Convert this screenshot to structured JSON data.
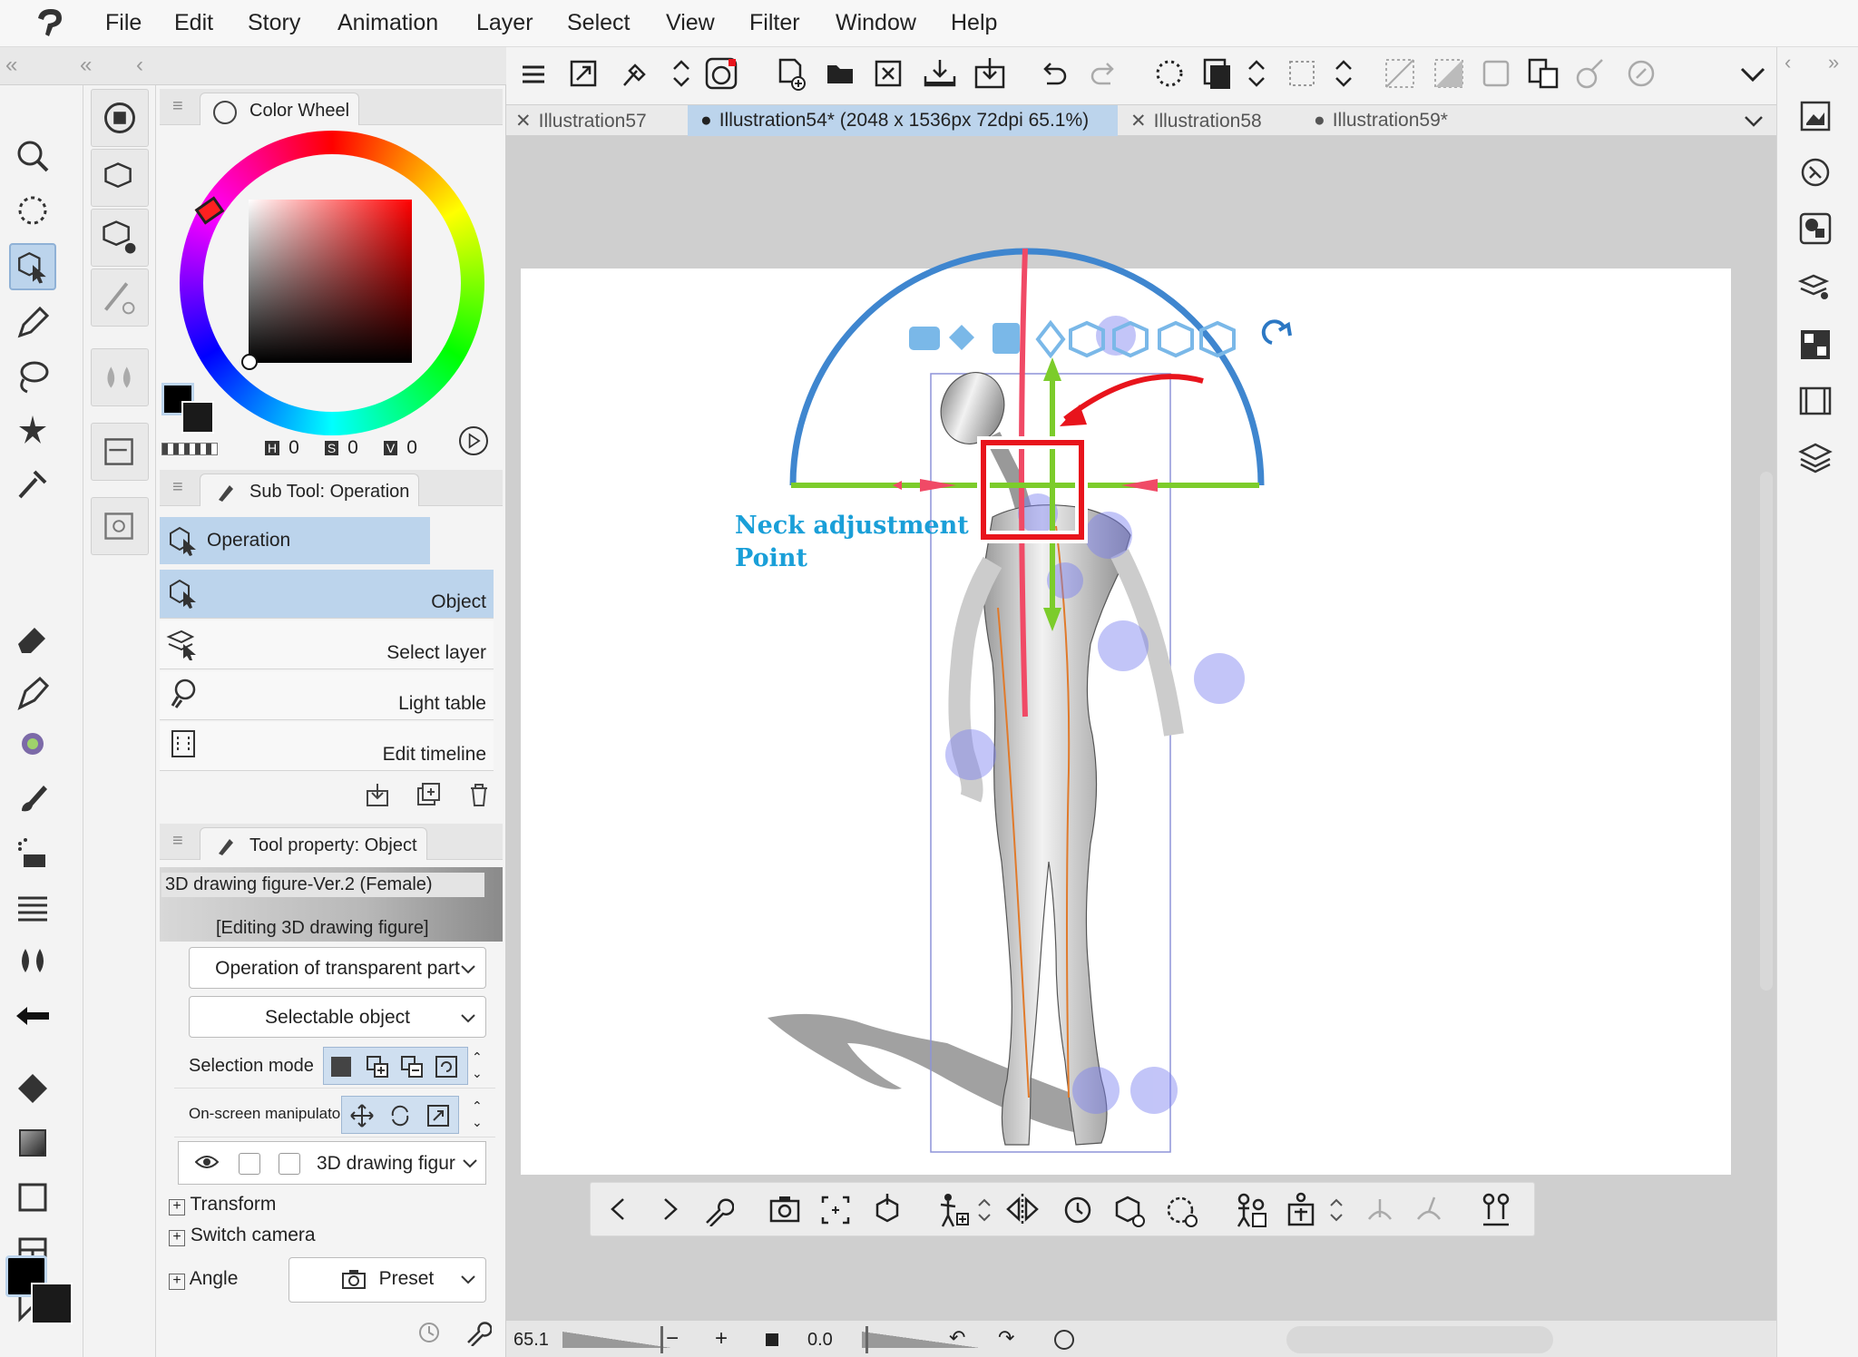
{
  "menu": [
    "File",
    "Edit",
    "Story",
    "Animation",
    "Layer",
    "Select",
    "View",
    "Filter",
    "Window",
    "Help"
  ],
  "color_wheel": {
    "tab_label": "Color Wheel",
    "h_label": "H",
    "h_value": "0",
    "s_label": "S",
    "s_value": "0",
    "v_label": "V",
    "v_value": "0"
  },
  "sub_tool": {
    "tab_label": "Sub Tool: Operation",
    "group": "Operation",
    "items": [
      "Object",
      "Select layer",
      "Light table",
      "Edit timeline"
    ]
  },
  "tool_property": {
    "tab_label": "Tool property: Object",
    "model_name": "3D drawing figure-Ver.2 (Female)",
    "editing_label": "[Editing 3D drawing figure]",
    "transparent_dropdown": "Operation of transparent part",
    "selectable_dropdown": "Selectable object",
    "selection_mode_label": "Selection mode",
    "manipulator_label": "On-screen manipulato",
    "figure_dropdown": "3D drawing figur",
    "transform_label": "Transform",
    "switch_camera_label": "Switch camera",
    "angle_label": "Angle",
    "preset_label": "Preset"
  },
  "doc_tabs": [
    "Illustration57",
    "Illustration54* (2048 x 1536px 72dpi 65.1%)",
    "Illustration58",
    "Illustration59*"
  ],
  "annotation": {
    "line1": "Neck adjustment",
    "line2": "Point"
  },
  "status": {
    "zoom": "65.1",
    "angle": "0.0"
  },
  "colors": {
    "accent": "#bcd4ec",
    "main_color": "#000000",
    "sub_color": "#1a1a1a",
    "annotation": "#1a9fd8",
    "highlight": "#e8141c"
  }
}
